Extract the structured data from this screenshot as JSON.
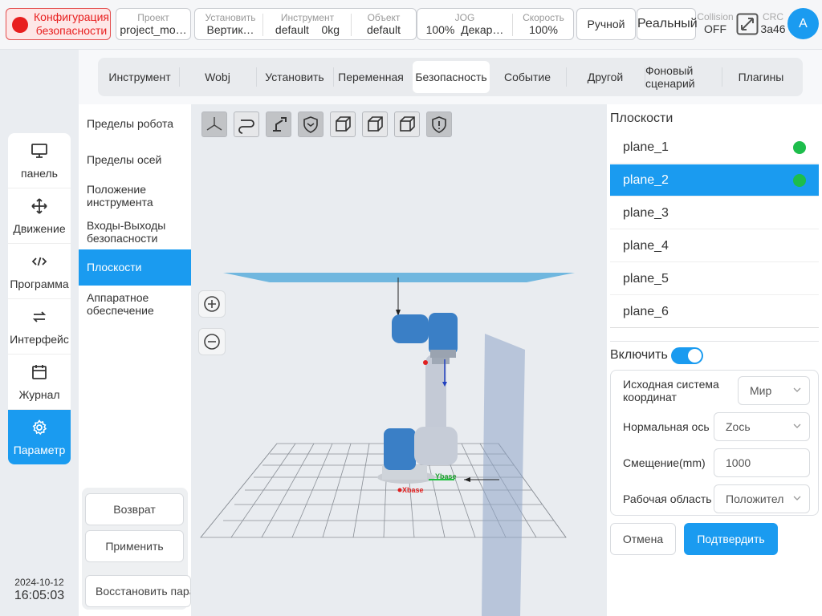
{
  "topbar": {
    "safety_label": "Конфигурация безопасности",
    "project": {
      "label": "Проект",
      "value": "project_mo…"
    },
    "install": {
      "label": "Установить",
      "value": "Вертик…"
    },
    "tool": {
      "label": "Инструмент",
      "value": "default",
      "payload": "0kg"
    },
    "object": {
      "label": "Объект",
      "value": "default"
    },
    "jog": {
      "label": "JOG",
      "value": "100%",
      "frame": "Декар…"
    },
    "speed": {
      "label": "Скорость",
      "value": "100%"
    },
    "mode_manual": "Ручной",
    "mode_real": "Реальный",
    "collision": {
      "label": "Collision",
      "value": "OFF"
    },
    "crc": {
      "label": "CRC",
      "value": "3a46"
    },
    "avatar": "A",
    "colors": {
      "accent": "#1a9bf0",
      "danger": "#e81f1f",
      "ok": "#1dbd4b"
    }
  },
  "sidebar": {
    "items": [
      {
        "label": "панель",
        "icon": "monitor-icon"
      },
      {
        "label": "Движение",
        "icon": "move-icon"
      },
      {
        "label": "Программа",
        "icon": "code-icon"
      },
      {
        "label": "Интерфейс",
        "icon": "swap-icon"
      },
      {
        "label": "Журнал",
        "icon": "calendar-icon"
      },
      {
        "label": "Параметр",
        "icon": "gear-icon"
      }
    ],
    "active_index": 5,
    "date": "2024-10-12",
    "time": "16:05:03"
  },
  "tabs": [
    "Инструмент",
    "Wobj",
    "Установить",
    "Переменная",
    "Безопасность",
    "Событие",
    "Другой",
    "Фоновый сценарий",
    "Плагины"
  ],
  "active_tab": "Безопасность",
  "submenu": {
    "items": [
      "Пределы робота",
      "Пределы осей",
      "Положение инструмента",
      "Входы-Выходы безопасности",
      "Плоскости",
      "Аппаратное обеспечение"
    ],
    "active": "Плоскости",
    "back_button": "Возврат",
    "apply_button": "Применить",
    "restore_button": "Восстановить пара"
  },
  "viewport": {
    "toolbar_icons": [
      "axes-view-icon",
      "path-view-icon",
      "robot-view-icon",
      "safety-shield-icon",
      "cube-front-icon",
      "cube-side-icon",
      "cube-top-icon",
      "shield-alert-icon"
    ],
    "axis_x_label": "Xbase",
    "axis_y_label": "Ybase"
  },
  "planes": {
    "title": "Плоскости",
    "items": [
      {
        "name": "plane_1",
        "enabled": true
      },
      {
        "name": "plane_2",
        "enabled": true
      },
      {
        "name": "plane_3",
        "enabled": false
      },
      {
        "name": "plane_4",
        "enabled": false
      },
      {
        "name": "plane_5",
        "enabled": false
      },
      {
        "name": "plane_6",
        "enabled": false
      }
    ],
    "selected": "plane_2",
    "enable_label": "Включить",
    "enabled": true,
    "form": {
      "ref_frame_label": "Исходная система координат",
      "ref_frame_value": "Мир",
      "normal_axis_label": "Нормальная ось",
      "normal_axis_value": "Zось",
      "offset_label": "Смещение(mm)",
      "offset_value": "1000",
      "work_area_label": "Рабочая область",
      "work_area_value": "Положител"
    },
    "cancel_button": "Отмена",
    "confirm_button": "Подтвердить"
  }
}
